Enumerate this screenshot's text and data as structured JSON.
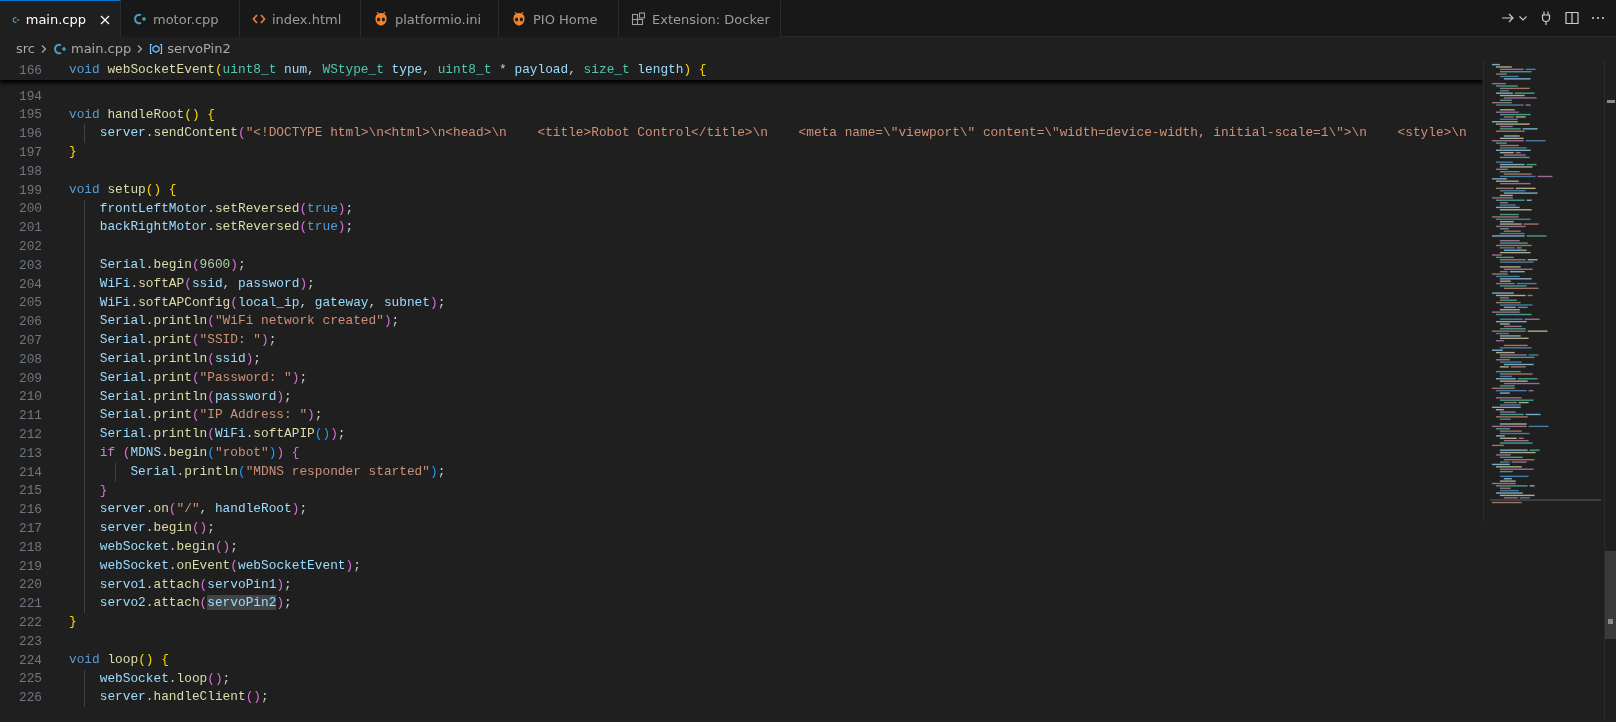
{
  "tabs": [
    {
      "label": "main.cpp",
      "kind": "cpp",
      "selected": true
    },
    {
      "label": "motor.cpp",
      "kind": "cpp",
      "selected": false
    },
    {
      "label": "index.html",
      "kind": "html",
      "selected": false
    },
    {
      "label": "platformio.ini",
      "kind": "pio",
      "selected": false
    },
    {
      "label": "PIO Home",
      "kind": "pio",
      "selected": false
    },
    {
      "label": "Extension: Docker",
      "kind": "extension",
      "selected": false
    }
  ],
  "breadcrumb": [
    {
      "label": "src",
      "kind": "folder"
    },
    {
      "label": "main.cpp",
      "kind": "cpp"
    },
    {
      "label": "servoPin2",
      "kind": "variable"
    }
  ],
  "editor": {
    "sticky_lines": [
      {
        "number": "166",
        "tokens": [
          {
            "text": "void ",
            "kind": "keyword"
          },
          {
            "text": "webSocketEvent",
            "kind": "function"
          },
          {
            "text": "(",
            "kind": "bracket1"
          },
          {
            "text": "uint8_t ",
            "kind": "type"
          },
          {
            "text": "num",
            "kind": "variable"
          },
          {
            "text": ", ",
            "kind": "punctuation"
          },
          {
            "text": "WStype_t ",
            "kind": "type"
          },
          {
            "text": "type",
            "kind": "variable"
          },
          {
            "text": ", ",
            "kind": "punctuation"
          },
          {
            "text": "uint8_t",
            "kind": "type"
          },
          {
            "text": " * ",
            "kind": "punctuation"
          },
          {
            "text": "payload",
            "kind": "variable"
          },
          {
            "text": ", ",
            "kind": "punctuation"
          },
          {
            "text": "size_t ",
            "kind": "type"
          },
          {
            "text": "length",
            "kind": "variable"
          },
          {
            "text": ")",
            "kind": "bracket1"
          },
          {
            "text": " {",
            "kind": "bracket1"
          }
        ]
      }
    ],
    "lines": [
      {
        "number": "194"
      },
      {
        "number": "195",
        "tokens": [
          {
            "text": "void ",
            "kind": "keyword"
          },
          {
            "text": "handleRoot",
            "kind": "function"
          },
          {
            "text": "()",
            "kind": "bracket1"
          },
          {
            "text": " {",
            "kind": "bracket1"
          }
        ]
      },
      {
        "number": "196",
        "tokens": [
          {
            "text": "    server",
            "kind": "variable"
          },
          {
            "text": ".",
            "kind": "punctuation"
          },
          {
            "text": "sendContent",
            "kind": "function"
          },
          {
            "text": "(",
            "kind": "bracket2"
          },
          {
            "text": "\"<!DOCTYPE html>\\n<html>\\n<head>\\n    <title>Robot Control</title>\\n    <meta name=\\\"viewport\\\" content=\\\"width=device-width, initial-scale=1\\\">\\n    <style>\\n",
            "kind": "string"
          }
        ]
      },
      {
        "number": "197",
        "tokens": [
          {
            "text": "}",
            "kind": "bracket1"
          }
        ]
      },
      {
        "number": "198"
      },
      {
        "number": "199",
        "tokens": [
          {
            "text": "void ",
            "kind": "keyword"
          },
          {
            "text": "setup",
            "kind": "function"
          },
          {
            "text": "()",
            "kind": "bracket1"
          },
          {
            "text": " {",
            "kind": "bracket1"
          }
        ]
      },
      {
        "number": "200",
        "tokens": [
          {
            "text": "    frontLeftMotor",
            "kind": "variable"
          },
          {
            "text": ".",
            "kind": "punctuation"
          },
          {
            "text": "setReversed",
            "kind": "function"
          },
          {
            "text": "(",
            "kind": "bracket2"
          },
          {
            "text": "true",
            "kind": "keyword"
          },
          {
            "text": ")",
            "kind": "bracket2"
          },
          {
            "text": ";",
            "kind": "punctuation"
          }
        ]
      },
      {
        "number": "201",
        "tokens": [
          {
            "text": "    backRightMotor",
            "kind": "variable"
          },
          {
            "text": ".",
            "kind": "punctuation"
          },
          {
            "text": "setReversed",
            "kind": "function"
          },
          {
            "text": "(",
            "kind": "bracket2"
          },
          {
            "text": "true",
            "kind": "keyword"
          },
          {
            "text": ")",
            "kind": "bracket2"
          },
          {
            "text": ";",
            "kind": "punctuation"
          }
        ]
      },
      {
        "number": "202"
      },
      {
        "number": "203",
        "tokens": [
          {
            "text": "    Serial",
            "kind": "variable"
          },
          {
            "text": ".",
            "kind": "punctuation"
          },
          {
            "text": "begin",
            "kind": "function"
          },
          {
            "text": "(",
            "kind": "bracket2"
          },
          {
            "text": "9600",
            "kind": "number"
          },
          {
            "text": ")",
            "kind": "bracket2"
          },
          {
            "text": ";",
            "kind": "punctuation"
          }
        ]
      },
      {
        "number": "204",
        "tokens": [
          {
            "text": "    WiFi",
            "kind": "variable"
          },
          {
            "text": ".",
            "kind": "punctuation"
          },
          {
            "text": "softAP",
            "kind": "function"
          },
          {
            "text": "(",
            "kind": "bracket2"
          },
          {
            "text": "ssid",
            "kind": "variable"
          },
          {
            "text": ", ",
            "kind": "punctuation"
          },
          {
            "text": "password",
            "kind": "variable"
          },
          {
            "text": ")",
            "kind": "bracket2"
          },
          {
            "text": ";",
            "kind": "punctuation"
          }
        ]
      },
      {
        "number": "205",
        "tokens": [
          {
            "text": "    WiFi",
            "kind": "variable"
          },
          {
            "text": ".",
            "kind": "punctuation"
          },
          {
            "text": "softAPConfig",
            "kind": "function"
          },
          {
            "text": "(",
            "kind": "bracket2"
          },
          {
            "text": "local_ip",
            "kind": "variable"
          },
          {
            "text": ", ",
            "kind": "punctuation"
          },
          {
            "text": "gateway",
            "kind": "variable"
          },
          {
            "text": ", ",
            "kind": "punctuation"
          },
          {
            "text": "subnet",
            "kind": "variable"
          },
          {
            "text": ")",
            "kind": "bracket2"
          },
          {
            "text": ";",
            "kind": "punctuation"
          }
        ]
      },
      {
        "number": "206",
        "tokens": [
          {
            "text": "    Serial",
            "kind": "variable"
          },
          {
            "text": ".",
            "kind": "punctuation"
          },
          {
            "text": "println",
            "kind": "function"
          },
          {
            "text": "(",
            "kind": "bracket2"
          },
          {
            "text": "\"WiFi network created\"",
            "kind": "string"
          },
          {
            "text": ")",
            "kind": "bracket2"
          },
          {
            "text": ";",
            "kind": "punctuation"
          }
        ]
      },
      {
        "number": "207",
        "tokens": [
          {
            "text": "    Serial",
            "kind": "variable"
          },
          {
            "text": ".",
            "kind": "punctuation"
          },
          {
            "text": "print",
            "kind": "function"
          },
          {
            "text": "(",
            "kind": "bracket2"
          },
          {
            "text": "\"SSID: \"",
            "kind": "string"
          },
          {
            "text": ")",
            "kind": "bracket2"
          },
          {
            "text": ";",
            "kind": "punctuation"
          }
        ]
      },
      {
        "number": "208",
        "tokens": [
          {
            "text": "    Serial",
            "kind": "variable"
          },
          {
            "text": ".",
            "kind": "punctuation"
          },
          {
            "text": "println",
            "kind": "function"
          },
          {
            "text": "(",
            "kind": "bracket2"
          },
          {
            "text": "ssid",
            "kind": "variable"
          },
          {
            "text": ")",
            "kind": "bracket2"
          },
          {
            "text": ";",
            "kind": "punctuation"
          }
        ]
      },
      {
        "number": "209",
        "tokens": [
          {
            "text": "    Serial",
            "kind": "variable"
          },
          {
            "text": ".",
            "kind": "punctuation"
          },
          {
            "text": "print",
            "kind": "function"
          },
          {
            "text": "(",
            "kind": "bracket2"
          },
          {
            "text": "\"Password: \"",
            "kind": "string"
          },
          {
            "text": ")",
            "kind": "bracket2"
          },
          {
            "text": ";",
            "kind": "punctuation"
          }
        ]
      },
      {
        "number": "210",
        "tokens": [
          {
            "text": "    Serial",
            "kind": "variable"
          },
          {
            "text": ".",
            "kind": "punctuation"
          },
          {
            "text": "println",
            "kind": "function"
          },
          {
            "text": "(",
            "kind": "bracket2"
          },
          {
            "text": "password",
            "kind": "variable"
          },
          {
            "text": ")",
            "kind": "bracket2"
          },
          {
            "text": ";",
            "kind": "punctuation"
          }
        ]
      },
      {
        "number": "211",
        "tokens": [
          {
            "text": "    Serial",
            "kind": "variable"
          },
          {
            "text": ".",
            "kind": "punctuation"
          },
          {
            "text": "print",
            "kind": "function"
          },
          {
            "text": "(",
            "kind": "bracket2"
          },
          {
            "text": "\"IP Address: \"",
            "kind": "string"
          },
          {
            "text": ")",
            "kind": "bracket2"
          },
          {
            "text": ";",
            "kind": "punctuation"
          }
        ]
      },
      {
        "number": "212",
        "tokens": [
          {
            "text": "    Serial",
            "kind": "variable"
          },
          {
            "text": ".",
            "kind": "punctuation"
          },
          {
            "text": "println",
            "kind": "function"
          },
          {
            "text": "(",
            "kind": "bracket2"
          },
          {
            "text": "WiFi",
            "kind": "variable"
          },
          {
            "text": ".",
            "kind": "punctuation"
          },
          {
            "text": "softAPIP",
            "kind": "function"
          },
          {
            "text": "()",
            "kind": "bracket3"
          },
          {
            "text": ")",
            "kind": "bracket2"
          },
          {
            "text": ";",
            "kind": "punctuation"
          }
        ]
      },
      {
        "number": "213",
        "tokens": [
          {
            "text": "    if ",
            "kind": "control"
          },
          {
            "text": "(",
            "kind": "bracket2"
          },
          {
            "text": "MDNS",
            "kind": "variable"
          },
          {
            "text": ".",
            "kind": "punctuation"
          },
          {
            "text": "begin",
            "kind": "function"
          },
          {
            "text": "(",
            "kind": "bracket3"
          },
          {
            "text": "\"robot\"",
            "kind": "string"
          },
          {
            "text": ")",
            "kind": "bracket3"
          },
          {
            "text": ")",
            "kind": "bracket2"
          },
          {
            "text": " {",
            "kind": "bracket2"
          }
        ]
      },
      {
        "number": "214",
        "tokens": [
          {
            "text": "        Serial",
            "kind": "variable"
          },
          {
            "text": ".",
            "kind": "punctuation"
          },
          {
            "text": "println",
            "kind": "function"
          },
          {
            "text": "(",
            "kind": "bracket3"
          },
          {
            "text": "\"MDNS responder started\"",
            "kind": "string"
          },
          {
            "text": ")",
            "kind": "bracket3"
          },
          {
            "text": ";",
            "kind": "punctuation"
          }
        ]
      },
      {
        "number": "215",
        "tokens": [
          {
            "text": "    }",
            "kind": "bracket2"
          }
        ]
      },
      {
        "number": "216",
        "tokens": [
          {
            "text": "    server",
            "kind": "variable"
          },
          {
            "text": ".",
            "kind": "punctuation"
          },
          {
            "text": "on",
            "kind": "function"
          },
          {
            "text": "(",
            "kind": "bracket2"
          },
          {
            "text": "\"/\"",
            "kind": "string"
          },
          {
            "text": ", ",
            "kind": "punctuation"
          },
          {
            "text": "handleRoot",
            "kind": "variable"
          },
          {
            "text": ")",
            "kind": "bracket2"
          },
          {
            "text": ";",
            "kind": "punctuation"
          }
        ]
      },
      {
        "number": "217",
        "tokens": [
          {
            "text": "    server",
            "kind": "variable"
          },
          {
            "text": ".",
            "kind": "punctuation"
          },
          {
            "text": "begin",
            "kind": "function"
          },
          {
            "text": "()",
            "kind": "bracket2"
          },
          {
            "text": ";",
            "kind": "punctuation"
          }
        ]
      },
      {
        "number": "218",
        "tokens": [
          {
            "text": "    webSocket",
            "kind": "variable"
          },
          {
            "text": ".",
            "kind": "punctuation"
          },
          {
            "text": "begin",
            "kind": "function"
          },
          {
            "text": "()",
            "kind": "bracket2"
          },
          {
            "text": ";",
            "kind": "punctuation"
          }
        ]
      },
      {
        "number": "219",
        "tokens": [
          {
            "text": "    webSocket",
            "kind": "variable"
          },
          {
            "text": ".",
            "kind": "punctuation"
          },
          {
            "text": "onEvent",
            "kind": "function"
          },
          {
            "text": "(",
            "kind": "bracket2"
          },
          {
            "text": "webSocketEvent",
            "kind": "variable"
          },
          {
            "text": ")",
            "kind": "bracket2"
          },
          {
            "text": ";",
            "kind": "punctuation"
          }
        ]
      },
      {
        "number": "220",
        "tokens": [
          {
            "text": "    servo1",
            "kind": "variable"
          },
          {
            "text": ".",
            "kind": "punctuation"
          },
          {
            "text": "attach",
            "kind": "function"
          },
          {
            "text": "(",
            "kind": "bracket2"
          },
          {
            "text": "servoPin1",
            "kind": "variable"
          },
          {
            "text": ")",
            "kind": "bracket2"
          },
          {
            "text": ";",
            "kind": "punctuation"
          }
        ]
      },
      {
        "number": "221",
        "tokens": [
          {
            "text": "    servo2",
            "kind": "variable"
          },
          {
            "text": ".",
            "kind": "punctuation"
          },
          {
            "text": "attach",
            "kind": "function"
          },
          {
            "text": "(",
            "kind": "bracket2"
          },
          {
            "text": "servoPin2",
            "kind": "match"
          },
          {
            "text": ")",
            "kind": "bracket2"
          },
          {
            "text": ";",
            "kind": "punctuation"
          }
        ]
      },
      {
        "number": "222",
        "tokens": [
          {
            "text": "}",
            "kind": "bracket1"
          }
        ]
      },
      {
        "number": "223"
      },
      {
        "number": "224",
        "tokens": [
          {
            "text": "void ",
            "kind": "keyword"
          },
          {
            "text": "loop",
            "kind": "function"
          },
          {
            "text": "()",
            "kind": "bracket1"
          },
          {
            "text": " {",
            "kind": "bracket1"
          }
        ]
      },
      {
        "number": "225",
        "tokens": [
          {
            "text": "    webSocket",
            "kind": "variable"
          },
          {
            "text": ".",
            "kind": "punctuation"
          },
          {
            "text": "loop",
            "kind": "function"
          },
          {
            "text": "()",
            "kind": "bracket2"
          },
          {
            "text": ";",
            "kind": "punctuation"
          }
        ]
      },
      {
        "number": "226",
        "tokens": [
          {
            "text": "    server",
            "kind": "variable"
          },
          {
            "text": ".",
            "kind": "punctuation"
          },
          {
            "text": "handleClient",
            "kind": "function"
          },
          {
            "text": "()",
            "kind": "bracket2"
          },
          {
            "text": ";",
            "kind": "punctuation"
          }
        ]
      }
    ]
  }
}
